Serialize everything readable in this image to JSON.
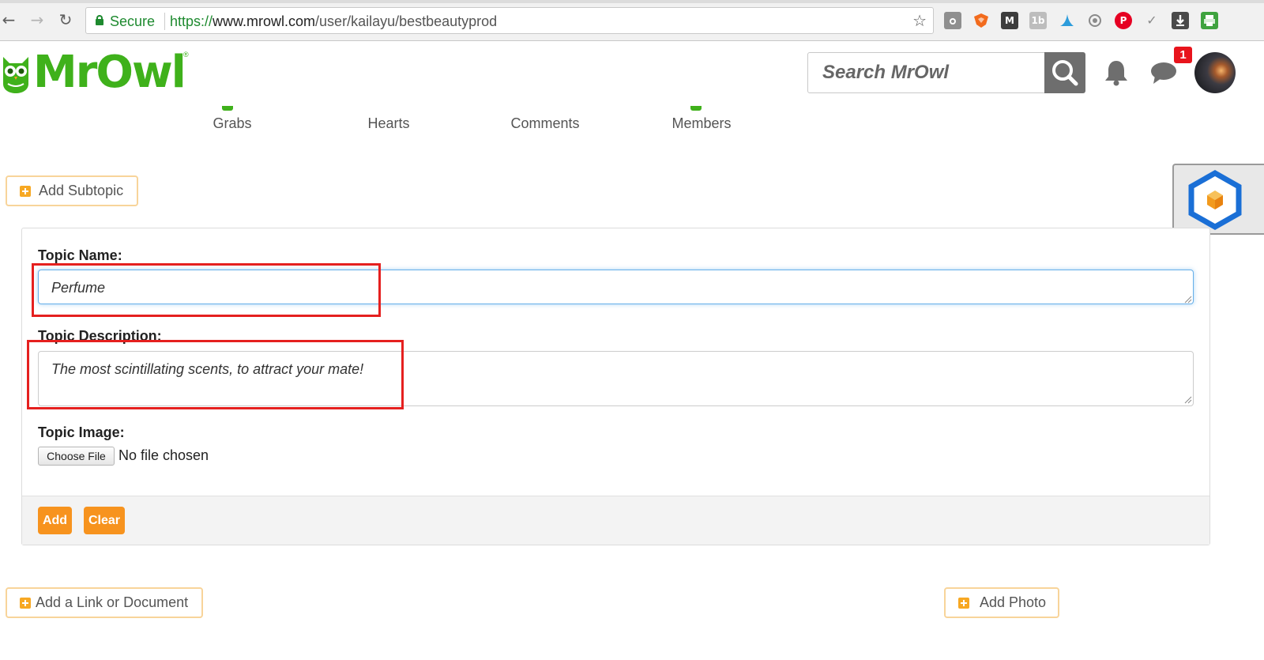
{
  "browser": {
    "secure_label": "Secure",
    "url_protocol": "https://",
    "url_host": "www.mrowl.com",
    "url_path": "/user/kailayu/bestbeautyprod",
    "extensions": [
      "camera-icon",
      "fox-icon",
      "m-icon",
      "1b-icon",
      "bird-icon",
      "eye-icon",
      "pinterest-icon",
      "check-icon",
      "download-icon",
      "printer-icon"
    ]
  },
  "header": {
    "logo_text": "MrOwl",
    "logo_reg": "®",
    "search_placeholder": "Search MrOwl",
    "notification_count": "1"
  },
  "stats": {
    "grabs": "Grabs",
    "hearts": "Hearts",
    "comments": "Comments",
    "members": "Members"
  },
  "actions": {
    "add_subtopic": "Add Subtopic",
    "add_link": "Add a Link or Document",
    "add_photo": "Add Photo"
  },
  "form": {
    "name_label": "Topic Name:",
    "name_value": "Perfume",
    "description_label": "Topic Description:",
    "description_value": "The most scintillating scents, to attract your mate!",
    "image_label": "Topic Image:",
    "choose_file_label": "Choose File",
    "no_file_label": "No file chosen",
    "add_label": "Add",
    "clear_label": "Clear"
  },
  "colors": {
    "brand_green": "#3fb11b",
    "accent_orange": "#f7931e",
    "highlight_red": "#e5201f",
    "badge_red": "#e8141c"
  }
}
